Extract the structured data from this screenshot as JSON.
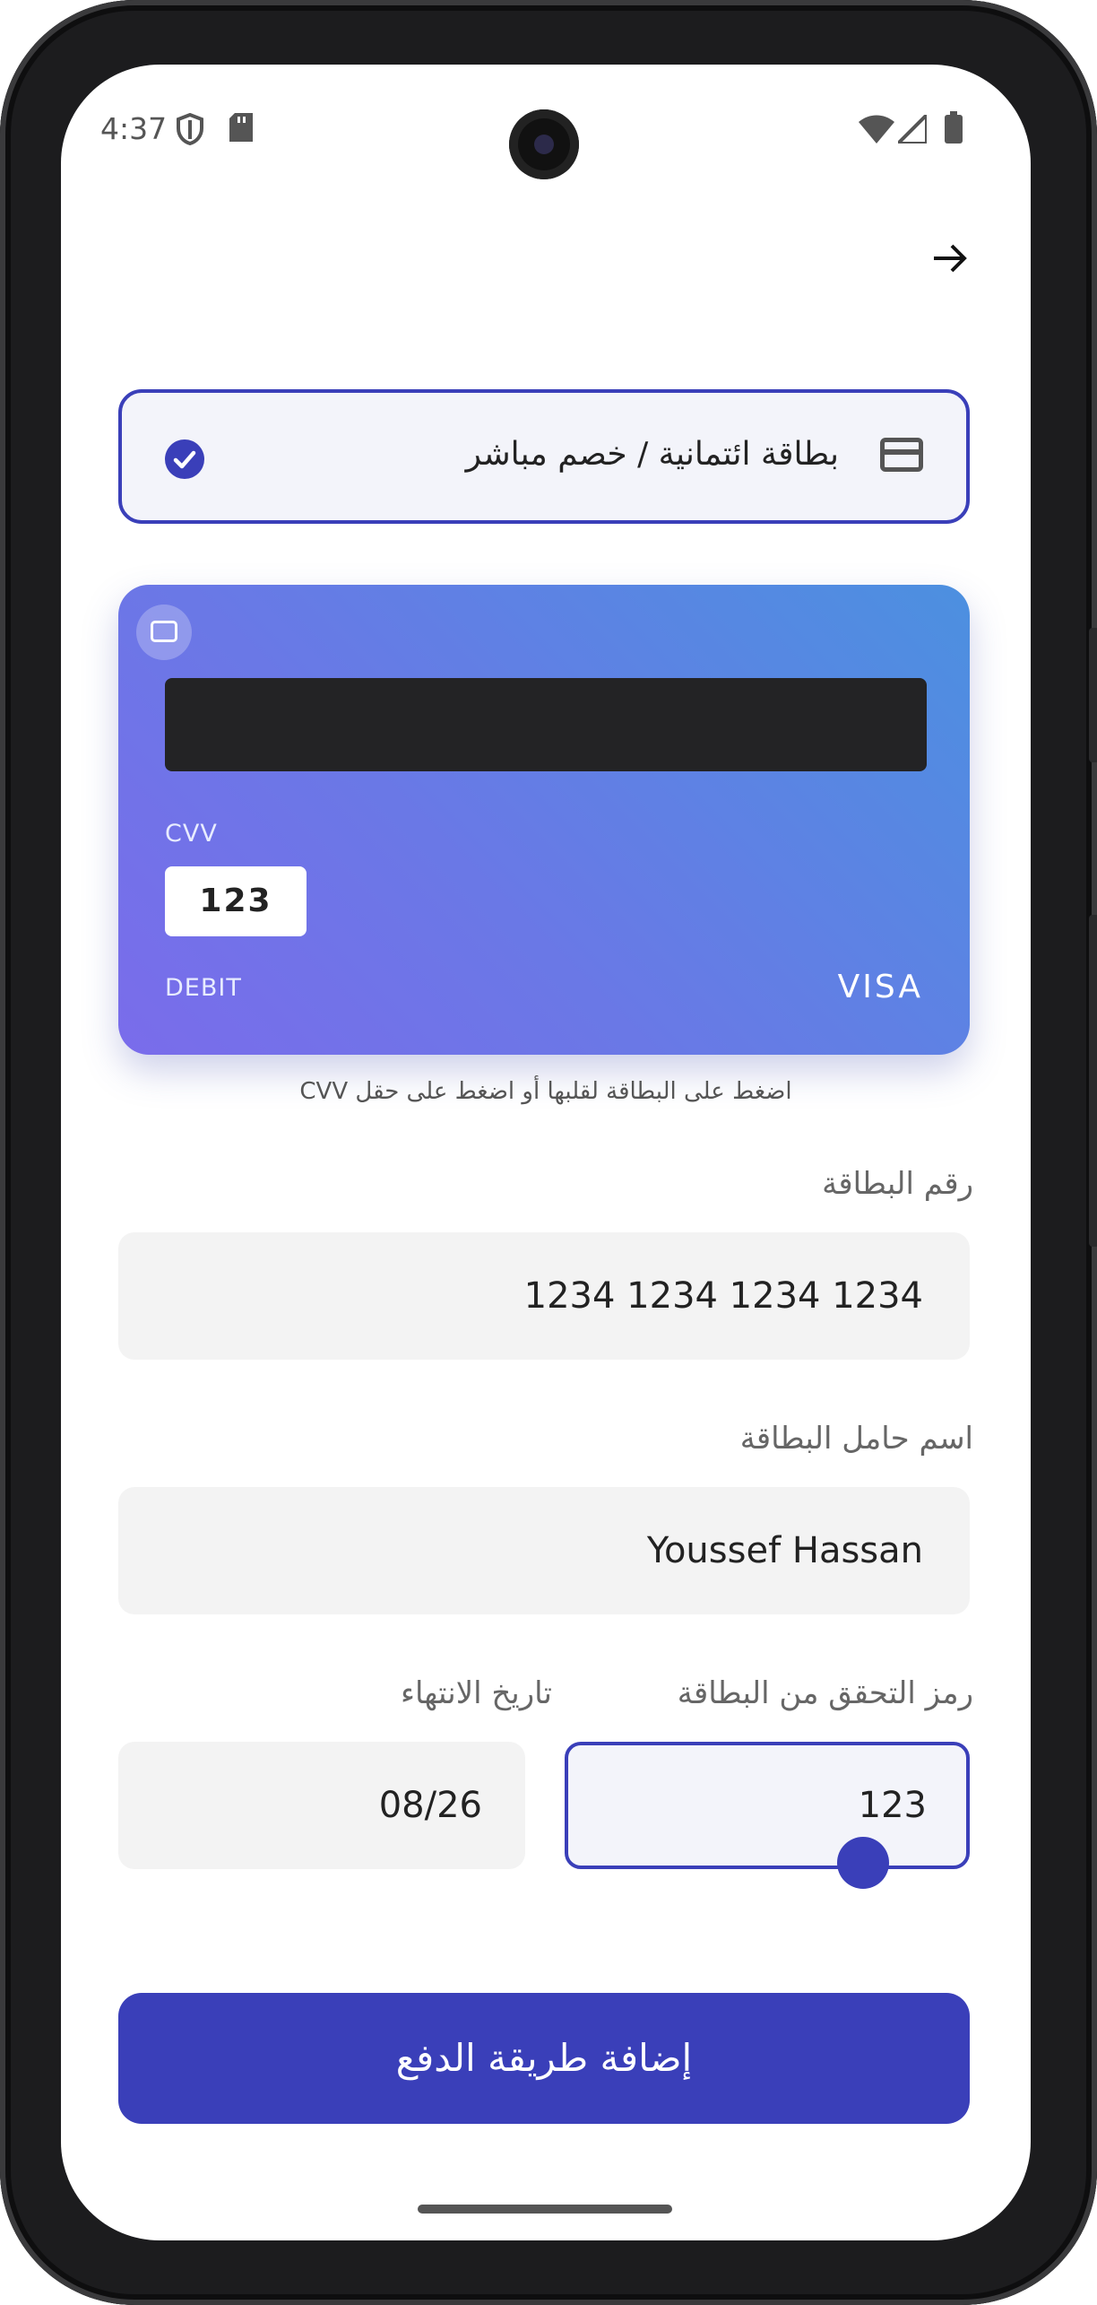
{
  "status_bar": {
    "time": "4:37",
    "icons": [
      "shield-icon",
      "sd-card-icon",
      "wifi-icon",
      "signal-icon",
      "battery-icon"
    ]
  },
  "nav": {
    "forward_icon": "arrow-right-icon"
  },
  "payment_option": {
    "label": "بطاقة ائتمانية / خصم مباشر",
    "selected": true
  },
  "card_preview": {
    "cvv_label": "CVV",
    "cvv_value": "123",
    "type_label": "DEBIT",
    "brand": "VISA"
  },
  "hint": "اضغط على البطاقة لقلبها أو اضغط على حقل CVV",
  "form": {
    "card_number": {
      "label": "رقم البطاقة",
      "value": "1234 1234 1234 1234"
    },
    "holder_name": {
      "label": "اسم حامل البطاقة",
      "value": "Youssef Hassan"
    },
    "cvv": {
      "label": "رمز التحقق من البطاقة",
      "value": "123"
    },
    "expiry": {
      "label": "تاريخ الانتهاء",
      "value": "08/26"
    }
  },
  "submit_label": "إضافة طريقة الدفع",
  "colors": {
    "accent": "#3a3fb9",
    "card_start": "#7a6ceb",
    "card_end": "#4c90e0"
  }
}
